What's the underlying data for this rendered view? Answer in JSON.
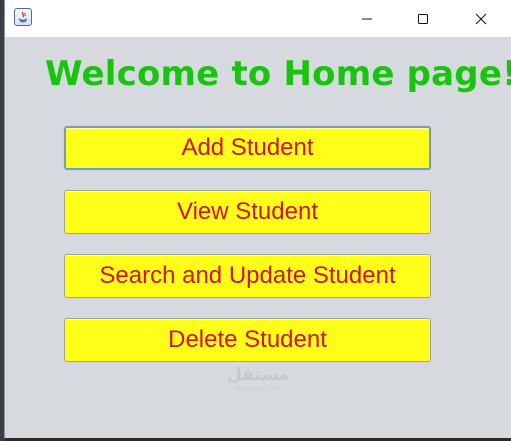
{
  "window": {
    "title": "",
    "controls": {
      "minimize": "minimize-icon",
      "maximize": "maximize-icon",
      "close": "close-icon"
    }
  },
  "main": {
    "heading": "Welcome to Home page!",
    "buttons": [
      {
        "label": "Add Student",
        "focused": true
      },
      {
        "label": "View Student",
        "focused": false
      },
      {
        "label": "Search and Update Student",
        "focused": false
      },
      {
        "label": "Delete Student",
        "focused": false
      }
    ]
  },
  "watermark": {
    "text": "مستقل",
    "subtext": "mostaql.com"
  },
  "colors": {
    "heading": "#19c40f",
    "button_background": "#ffff1a",
    "button_text": "#d2142e",
    "panel_background": "#d6d9de",
    "titlebar_background": "#ffffff"
  }
}
